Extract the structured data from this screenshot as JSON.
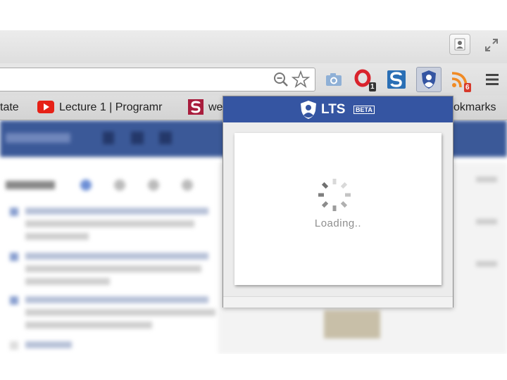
{
  "bookmarks": {
    "items": [
      {
        "label": "tate"
      },
      {
        "label": "Lecture 1 | Programr"
      },
      {
        "label": "we"
      },
      {
        "label": "okmarks"
      }
    ]
  },
  "extensions": {
    "opera_badge": "1",
    "rss_badge": "6"
  },
  "popup": {
    "logo_text": "LTS",
    "beta_label": "BETA",
    "loading_text": "Loading.."
  },
  "colors": {
    "popup_header": "#3555a2",
    "page_header": "#3b5998",
    "badge": "#d6392b"
  }
}
